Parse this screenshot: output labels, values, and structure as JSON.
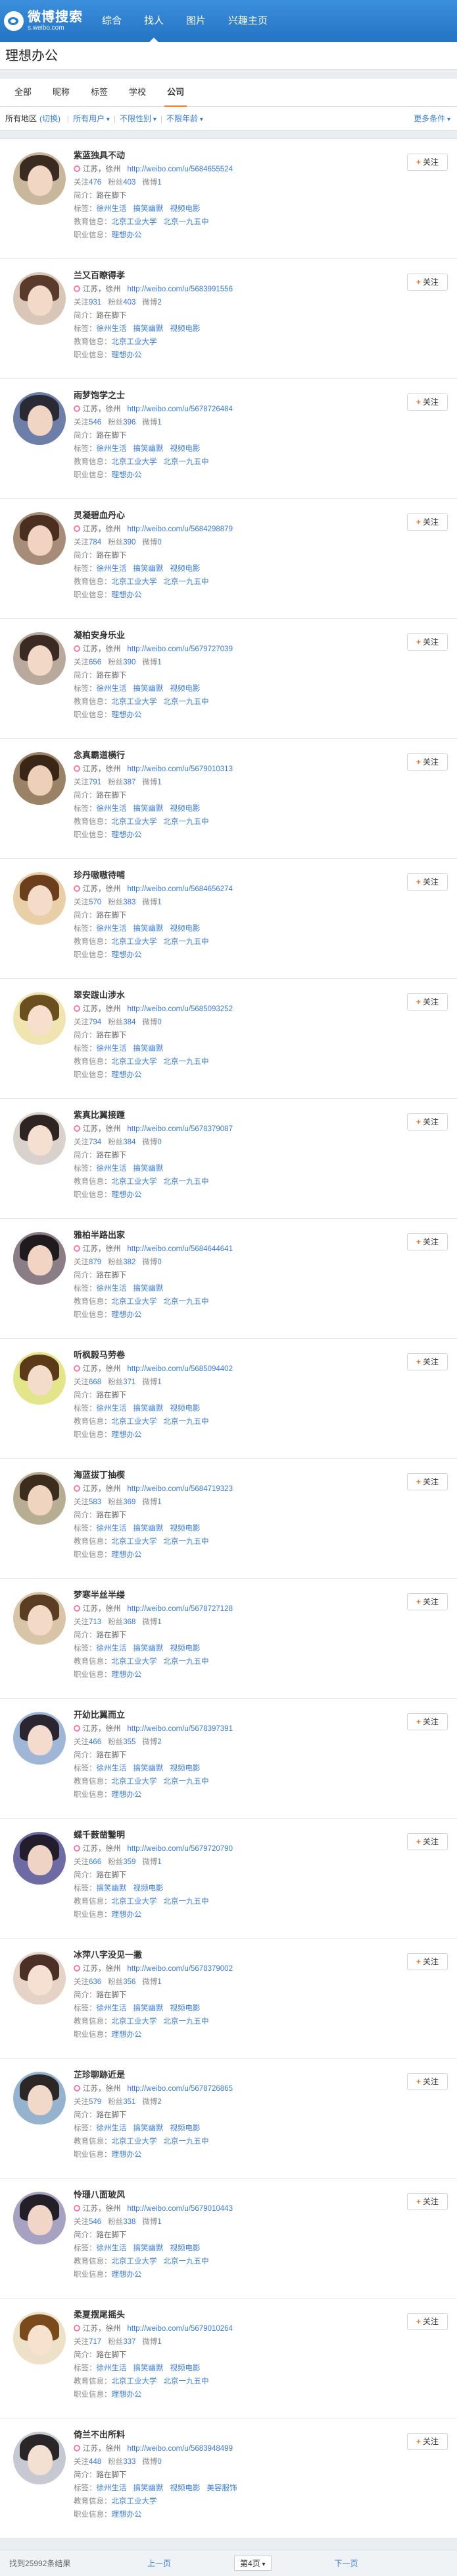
{
  "topbar": {
    "logo_name": "微博搜索",
    "logo_url": "s.weibo.com",
    "nav": [
      {
        "label": "综合"
      },
      {
        "label": "找人"
      },
      {
        "label": "图片"
      },
      {
        "label": "兴趣主页"
      }
    ],
    "active_nav": 1
  },
  "page_title": "理想办公",
  "tabs": [
    {
      "label": "全部"
    },
    {
      "label": "昵称"
    },
    {
      "label": "标签"
    },
    {
      "label": "学校"
    },
    {
      "label": "公司"
    }
  ],
  "active_tab": 4,
  "filters": {
    "region_label": "所有地区",
    "region_value": "(切换)",
    "user_type": "所有用户",
    "gender": "不限性别",
    "age": "不限年龄",
    "more": "更多条件"
  },
  "labels": {
    "follows": "关注",
    "fans": "粉丝",
    "weibo": "微博",
    "intro": "简介：",
    "tags": "标签：",
    "edu": "教育信息：",
    "job": "职业信息：",
    "follow_button": "关注"
  },
  "users": [
    {
      "name": "紫蓝独具不动",
      "location": "江苏，徐州",
      "url": "http://weibo.com/u/5684655524",
      "follows": "476",
      "fans": "403",
      "weibo": "1",
      "intro": "路在脚下",
      "tags": [
        "徐州生活",
        "搞笑幽默",
        "视频电影"
      ],
      "edu": [
        "北京工业大学",
        "北京一九五中"
      ],
      "job": "理想办公"
    },
    {
      "name": "兰又百瞭得孝",
      "location": "江苏，徐州",
      "url": "http://weibo.com/u/5683991556",
      "follows": "931",
      "fans": "403",
      "weibo": "2",
      "intro": "路在脚下",
      "tags": [
        "徐州生活",
        "搞笑幽默",
        "视频电影"
      ],
      "edu": [
        "北京工业大学"
      ],
      "job": "理想办公"
    },
    {
      "name": "雨梦饱学之士",
      "location": "江苏，徐州",
      "url": "http://weibo.com/u/5678726484",
      "follows": "546",
      "fans": "396",
      "weibo": "1",
      "intro": "路在脚下",
      "tags": [
        "徐州生活",
        "搞笑幽默",
        "视频电影"
      ],
      "edu": [
        "北京工业大学",
        "北京一九五中"
      ],
      "job": "理想办公"
    },
    {
      "name": "灵凝碧血丹心",
      "location": "江苏，徐州",
      "url": "http://weibo.com/u/5684298879",
      "follows": "784",
      "fans": "390",
      "weibo": "0",
      "intro": "路在脚下",
      "tags": [
        "徐州生活",
        "搞笑幽默",
        "视频电影"
      ],
      "edu": [
        "北京工业大学",
        "北京一九五中"
      ],
      "job": "理想办公"
    },
    {
      "name": "凝柏安身乐业",
      "location": "江苏，徐州",
      "url": "http://weibo.com/u/5679727039",
      "follows": "656",
      "fans": "390",
      "weibo": "1",
      "intro": "路在脚下",
      "tags": [
        "徐州生活",
        "搞笑幽默",
        "视频电影"
      ],
      "edu": [
        "北京工业大学",
        "北京一九五中"
      ],
      "job": "理想办公"
    },
    {
      "name": "念真霸道横行",
      "location": "江苏，徐州",
      "url": "http://weibo.com/u/5679010313",
      "follows": "791",
      "fans": "387",
      "weibo": "1",
      "intro": "路在脚下",
      "tags": [
        "徐州生活",
        "搞笑幽默",
        "视频电影"
      ],
      "edu": [
        "北京工业大学",
        "北京一九五中"
      ],
      "job": "理想办公"
    },
    {
      "name": "珍丹嗷嗷待哺",
      "location": "江苏，徐州",
      "url": "http://weibo.com/u/5684656274",
      "follows": "570",
      "fans": "383",
      "weibo": "1",
      "intro": "路在脚下",
      "tags": [
        "徐州生活",
        "搞笑幽默",
        "视频电影"
      ],
      "edu": [
        "北京工业大学",
        "北京一九五中"
      ],
      "job": "理想办公"
    },
    {
      "name": "翠安跋山涉水",
      "location": "江苏，徐州",
      "url": "http://weibo.com/u/5685093252",
      "follows": "794",
      "fans": "384",
      "weibo": "0",
      "intro": "路在脚下",
      "tags": [
        "徐州生活",
        "搞笑幽默"
      ],
      "edu": [
        "北京工业大学",
        "北京一九五中"
      ],
      "job": "理想办公"
    },
    {
      "name": "紫真比翼接踵",
      "location": "江苏，徐州",
      "url": "http://weibo.com/u/5678379087",
      "follows": "734",
      "fans": "384",
      "weibo": "0",
      "intro": "路在脚下",
      "tags": [
        "徐州生活",
        "搞笑幽默"
      ],
      "edu": [
        "北京工业大学",
        "北京一九五中"
      ],
      "job": "理想办公"
    },
    {
      "name": "雅柏半路出家",
      "location": "江苏，徐州",
      "url": "http://weibo.com/u/5684644641",
      "follows": "879",
      "fans": "382",
      "weibo": "0",
      "intro": "路在脚下",
      "tags": [
        "徐州生活",
        "搞笑幽默"
      ],
      "edu": [
        "北京工业大学",
        "北京一九五中"
      ],
      "job": "理想办公"
    },
    {
      "name": "听枫毅马劳卷",
      "location": "江苏，徐州",
      "url": "http://weibo.com/u/5685094402",
      "follows": "668",
      "fans": "371",
      "weibo": "1",
      "intro": "路在脚下",
      "tags": [
        "徐州生活",
        "搞笑幽默",
        "视频电影"
      ],
      "edu": [
        "北京工业大学",
        "北京一九五中"
      ],
      "job": "理想办公"
    },
    {
      "name": "海蓝拔丁抽楔",
      "location": "江苏，徐州",
      "url": "http://weibo.com/u/5684719323",
      "follows": "583",
      "fans": "369",
      "weibo": "1",
      "intro": "路在脚下",
      "tags": [
        "徐州生活",
        "搞笑幽默",
        "视频电影"
      ],
      "edu": [
        "北京工业大学",
        "北京一九五中"
      ],
      "job": "理想办公"
    },
    {
      "name": "梦寒半丝半缕",
      "location": "江苏，徐州",
      "url": "http://weibo.com/u/5678727128",
      "follows": "713",
      "fans": "368",
      "weibo": "1",
      "intro": "路在脚下",
      "tags": [
        "徐州生活",
        "搞笑幽默",
        "视频电影"
      ],
      "edu": [
        "北京工业大学",
        "北京一九五中"
      ],
      "job": "理想办公"
    },
    {
      "name": "开幼比翼而立",
      "location": "江苏，徐州",
      "url": "http://weibo.com/u/5678397391",
      "follows": "466",
      "fans": "355",
      "weibo": "2",
      "intro": "路在脚下",
      "tags": [
        "徐州生活",
        "搞笑幽默",
        "视频电影"
      ],
      "edu": [
        "北京工业大学",
        "北京一九五中"
      ],
      "job": "理想办公"
    },
    {
      "name": "蝶千薮凿鑿明",
      "location": "江苏，徐州",
      "url": "http://weibo.com/u/5679720790",
      "follows": "666",
      "fans": "359",
      "weibo": "1",
      "intro": "路在脚下",
      "tags": [
        "搞笑幽默",
        "视频电影"
      ],
      "edu": [
        "北京工业大学",
        "北京一九五中"
      ],
      "job": "理想办公"
    },
    {
      "name": "冰萍八字没见一撇",
      "location": "江苏，徐州",
      "url": "http://weibo.com/u/5678379002",
      "follows": "636",
      "fans": "356",
      "weibo": "1",
      "intro": "路在脚下",
      "tags": [
        "徐州生活",
        "搞笑幽默",
        "视频电影"
      ],
      "edu": [
        "北京工业大学",
        "北京一九五中"
      ],
      "job": "理想办公"
    },
    {
      "name": "芷珍聊跡近是",
      "location": "江苏，徐州",
      "url": "http://weibo.com/u/5678726865",
      "follows": "579",
      "fans": "351",
      "weibo": "2",
      "intro": "路在脚下",
      "tags": [
        "徐州生活",
        "搞笑幽默",
        "视频电影"
      ],
      "edu": [
        "北京工业大学",
        "北京一九五中"
      ],
      "job": "理想办公"
    },
    {
      "name": "怜珊八面玻风",
      "location": "江苏，徐州",
      "url": "http://weibo.com/u/5679010443",
      "follows": "546",
      "fans": "338",
      "weibo": "1",
      "intro": "路在脚下",
      "tags": [
        "徐州生活",
        "搞笑幽默",
        "视频电影"
      ],
      "edu": [
        "北京工业大学",
        "北京一九五中"
      ],
      "job": "理想办公"
    },
    {
      "name": "柔夏摆尾摇头",
      "location": "江苏，徐州",
      "url": "http://weibo.com/u/5679010264",
      "follows": "717",
      "fans": "337",
      "weibo": "1",
      "intro": "路在脚下",
      "tags": [
        "徐州生活",
        "搞笑幽默",
        "视频电影"
      ],
      "edu": [
        "北京工业大学",
        "北京一九五中"
      ],
      "job": "理想办公"
    },
    {
      "name": "倚兰不出所料",
      "location": "江苏，徐州",
      "url": "http://weibo.com/u/5683948499",
      "follows": "448",
      "fans": "333",
      "weibo": "0",
      "intro": "路在脚下",
      "tags": [
        "徐州生活",
        "搞笑幽默",
        "视频电影",
        "美容服饰"
      ],
      "edu": [
        "北京工业大学"
      ],
      "job": "理想办公"
    }
  ],
  "pager": {
    "total": "找到25992条结果",
    "prev": "上一页",
    "page": "第4页",
    "next": "下一页"
  }
}
